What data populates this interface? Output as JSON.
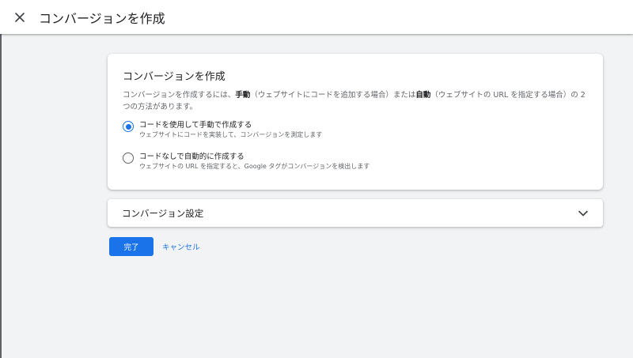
{
  "header": {
    "title": "コンバージョンを作成",
    "close_icon": "close-icon"
  },
  "card": {
    "title": "コンバージョンを作成",
    "desc_parts": [
      "コンバージョンを作成するには、",
      "手動",
      "（ウェブサイトにコードを追加する場合）または",
      "自動",
      "（ウェブサイトの URL を指定する場合）の 2 つの方法があります。"
    ],
    "options": [
      {
        "label": "コードを使用して手動で作成する",
        "sub": "ウェブサイトにコードを実装して、コンバージョンを測定します",
        "checked": true
      },
      {
        "label": "コードなしで自動的に作成する",
        "sub": "ウェブサイトの URL を指定すると、Google タグがコンバージョンを検出します",
        "checked": false
      }
    ]
  },
  "settings_panel": {
    "title": "コンバージョン設定",
    "icon": "chevron-down-icon",
    "expanded": false
  },
  "actions": {
    "done_label": "完了",
    "cancel_label": "キャンセル"
  },
  "colors": {
    "accent": "#1a73e8",
    "background": "#f1f3f4",
    "text_primary": "#202124",
    "text_secondary": "#5f6368"
  }
}
